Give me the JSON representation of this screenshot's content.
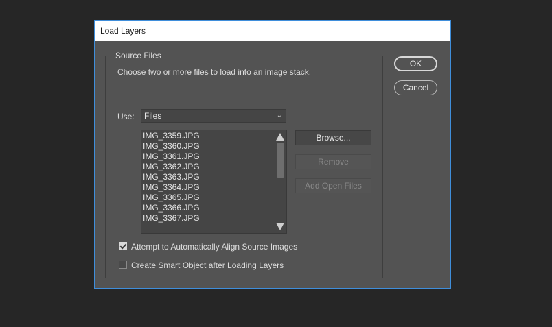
{
  "dialog": {
    "title": "Load Layers",
    "source_files": {
      "legend": "Source Files",
      "description": "Choose two or more files to load into an image stack.",
      "use_label": "Use:",
      "use_value": "Files",
      "files": [
        "IMG_3359.JPG",
        "IMG_3360.JPG",
        "IMG_3361.JPG",
        "IMG_3362.JPG",
        "IMG_3363.JPG",
        "IMG_3364.JPG",
        "IMG_3365.JPG",
        "IMG_3366.JPG",
        "IMG_3367.JPG"
      ],
      "browse_label": "Browse...",
      "remove_label": "Remove",
      "add_open_files_label": "Add Open Files"
    },
    "options": {
      "align_label": "Attempt to Automatically Align Source Images",
      "align_checked": true,
      "smart_object_label": "Create Smart Object after Loading Layers",
      "smart_object_checked": false
    },
    "ok_label": "OK",
    "cancel_label": "Cancel"
  },
  "colors": {
    "page_background": "#262626",
    "dialog_background": "#535353",
    "dialog_border": "#3f8edb",
    "titlebar_background": "#ffffff"
  }
}
